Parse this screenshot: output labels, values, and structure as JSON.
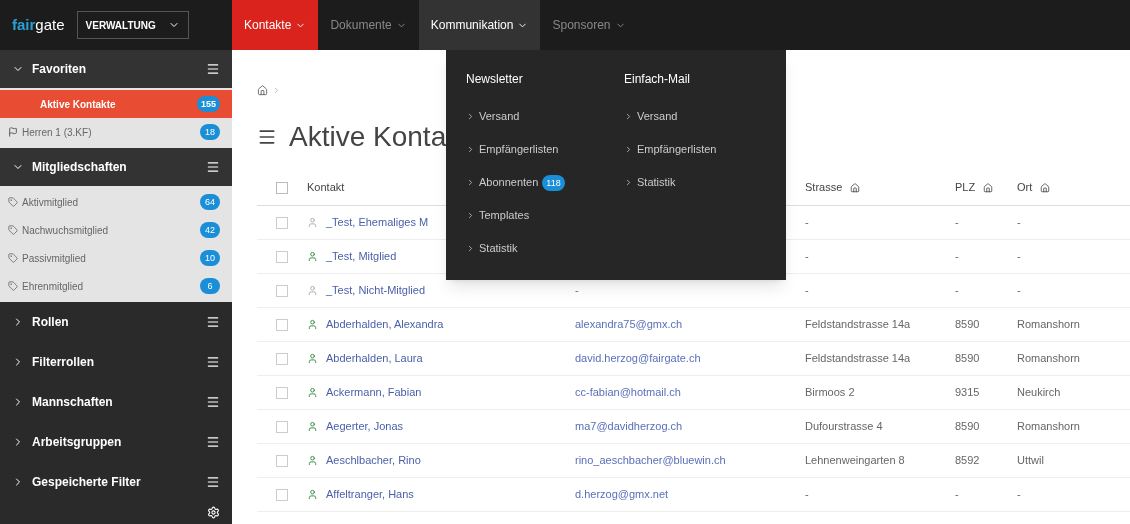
{
  "topbar": {
    "logo": [
      "fair",
      "gate"
    ],
    "module_select": "VERWALTUNG",
    "nav": [
      {
        "label": "Kontakte",
        "selected": true,
        "hovered": false
      },
      {
        "label": "Dokumente",
        "selected": false,
        "hovered": false
      },
      {
        "label": "Kommunikation",
        "selected": false,
        "hovered": true
      },
      {
        "label": "Sponsoren",
        "selected": false,
        "hovered": false
      }
    ]
  },
  "sidebar": {
    "sections": [
      {
        "title": "Favoriten",
        "expanded": true,
        "items": [
          {
            "label": "Aktive Kontakte",
            "count": "155",
            "selected": true,
            "kind": "plain"
          },
          {
            "label": "Herren 1 (3.KF)",
            "count": "18",
            "selected": false,
            "kind": "team"
          }
        ]
      },
      {
        "title": "Mitgliedschaften",
        "expanded": true,
        "items": [
          {
            "label": "Aktivmitglied",
            "count": "64",
            "selected": false,
            "kind": "tag"
          },
          {
            "label": "Nachwuchsmitglied",
            "count": "42",
            "selected": false,
            "kind": "tag"
          },
          {
            "label": "Passivmitglied",
            "count": "10",
            "selected": false,
            "kind": "tag"
          },
          {
            "label": "Ehrenmitglied",
            "count": "6",
            "selected": false,
            "kind": "tag"
          }
        ]
      },
      {
        "title": "Rollen",
        "expanded": false
      },
      {
        "title": "Filterrollen",
        "expanded": false
      },
      {
        "title": "Mannschaften",
        "expanded": false
      },
      {
        "title": "Arbeitsgruppen",
        "expanded": false
      },
      {
        "title": "Gespeicherte Filter",
        "expanded": false
      }
    ]
  },
  "page": {
    "title": "Aktive Konta",
    "table": {
      "select_all_checked": false,
      "columns": [
        {
          "label": "Kontakt",
          "icon": false
        },
        {
          "label": "Strasse",
          "icon": true
        },
        {
          "label": "PLZ",
          "icon": true
        },
        {
          "label": "Ort",
          "icon": true
        }
      ],
      "rows": [
        {
          "checked": false,
          "kontakt": "_Test, Ehemaliges M",
          "email": "",
          "strasse": "-",
          "plz": "-",
          "ort": "-",
          "member": false
        },
        {
          "checked": false,
          "kontakt": "_Test, Mitglied",
          "email": "",
          "strasse": "-",
          "plz": "-",
          "ort": "-",
          "member": true
        },
        {
          "checked": false,
          "kontakt": "_Test, Nicht-Mitglied",
          "email": "-",
          "strasse": "-",
          "plz": "-",
          "ort": "-",
          "member": false
        },
        {
          "checked": false,
          "kontakt": "Abderhalden, Alexandra",
          "email": "alexandra75@gmx.ch",
          "strasse": "Feldstandstrasse 14a",
          "plz": "8590",
          "ort": "Romanshorn",
          "member": true
        },
        {
          "checked": false,
          "kontakt": "Abderhalden, Laura",
          "email": "david.herzog@fairgate.ch",
          "strasse": "Feldstandstrasse 14a",
          "plz": "8590",
          "ort": "Romanshorn",
          "member": true
        },
        {
          "checked": false,
          "kontakt": "Ackermann, Fabian",
          "email": "cc-fabian@hotmail.ch",
          "strasse": "Birmoos 2",
          "plz": "9315",
          "ort": "Neukirch",
          "member": true
        },
        {
          "checked": false,
          "kontakt": "Aegerter, Jonas",
          "email": "ma7@davidherzog.ch",
          "strasse": "Dufourstrasse 4",
          "plz": "8590",
          "ort": "Romanshorn",
          "member": true
        },
        {
          "checked": false,
          "kontakt": "Aeschlbacher, Rino",
          "email": "rino_aeschbacher@bluewin.ch",
          "strasse": "Lehnenweingarten 8",
          "plz": "8592",
          "ort": "Uttwil",
          "member": true
        },
        {
          "checked": false,
          "kontakt": "Affeltranger, Hans",
          "email": "d.herzog@gmx.net",
          "strasse": "-",
          "plz": "-",
          "ort": "-",
          "member": true
        }
      ]
    }
  },
  "dropdown": {
    "columns": [
      {
        "heading": "Newsletter",
        "items": [
          {
            "label": "Versand"
          },
          {
            "label": "Empfängerlisten"
          },
          {
            "label": "Abonnenten",
            "count": "118"
          },
          {
            "label": "Templates"
          },
          {
            "label": "Statistik"
          }
        ]
      },
      {
        "heading": "Einfach-Mail",
        "items": [
          {
            "label": "Versand"
          },
          {
            "label": "Empfängerlisten"
          },
          {
            "label": "Statistik"
          }
        ]
      }
    ]
  }
}
